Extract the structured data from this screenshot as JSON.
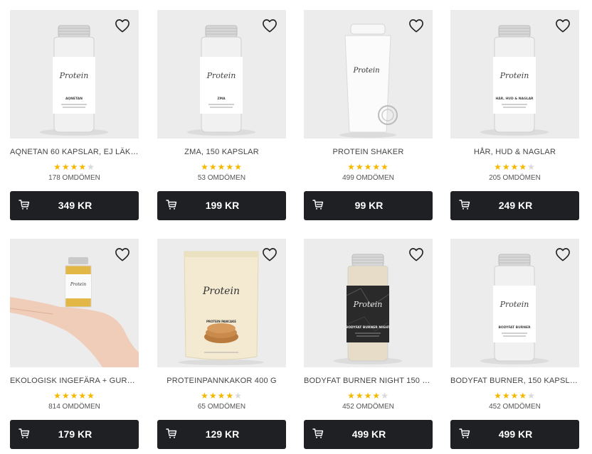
{
  "products": [
    {
      "title": "AQNETAN 60 KAPSLAR, EJ LÄKE...",
      "rating": 4,
      "reviews": "178 OMDÖMEN",
      "price": "349 KR",
      "label": "AQNETAN",
      "image": "capsule-jar-white-icon"
    },
    {
      "title": "ZMA, 150 KAPSLAR",
      "rating": 5,
      "reviews": "53 OMDÖMEN",
      "price": "199 KR",
      "label": "ZMA",
      "image": "capsule-jar-white-icon"
    },
    {
      "title": "PROTEIN SHAKER",
      "rating": 5,
      "reviews": "499 OMDÖMEN",
      "price": "99 KR",
      "label": "",
      "image": "shaker-bottle-icon"
    },
    {
      "title": "HÅR, HUD & NAGLAR",
      "rating": 4,
      "reviews": "205 OMDÖMEN",
      "price": "249 KR",
      "label": "HÅR, HUD & NAGLAR",
      "image": "capsule-jar-white-icon"
    },
    {
      "title": "EKOLOGISK INGEFÄRA + GURKM...",
      "rating": 5,
      "reviews": "814 OMDÖMEN",
      "price": "179 KR",
      "label": "",
      "image": "hand-holding-jar-icon"
    },
    {
      "title": "PROTEINPANNKAKOR 400 G",
      "rating": 4,
      "reviews": "65 OMDÖMEN",
      "price": "129 KR",
      "label": "PROTEIN PANCAKE",
      "image": "pouch-icon"
    },
    {
      "title": "BODYFAT BURNER NIGHT 150 KA...",
      "rating": 4,
      "reviews": "452 OMDÖMEN",
      "price": "499 KR",
      "label": "BODYFAT BURNER NIGHT",
      "image": "capsule-jar-black-icon"
    },
    {
      "title": "BODYFAT BURNER, 150 KAPSLAR",
      "rating": 4,
      "reviews": "452 OMDÖMEN",
      "price": "499 KR",
      "label": "BODYFAT BURNER",
      "image": "capsule-jar-white-icon"
    }
  ],
  "brand": "Protein",
  "colors": {
    "button_bg": "#1f2023",
    "star": "#f5b800",
    "star_empty": "#d9d9d9",
    "tile_bg": "#ececec"
  },
  "icons": {
    "heart": "heart-outline-icon",
    "cart": "cart-icon"
  }
}
